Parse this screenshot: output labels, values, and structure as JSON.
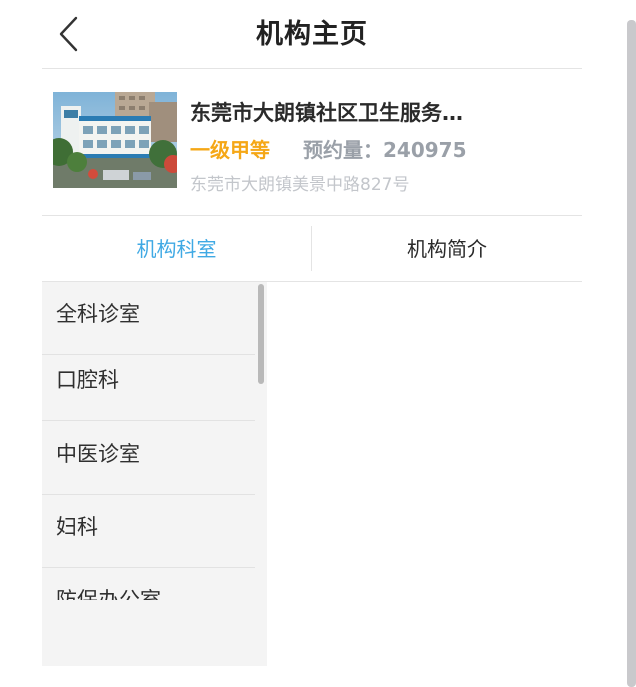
{
  "header": {
    "title": "机构主页"
  },
  "org": {
    "name": "东莞市大朗镇社区卫生服务…",
    "level": "一级甲等",
    "appointments": "预约量：240975",
    "address": "东莞市大朗镇美景中路827号"
  },
  "tabs": [
    {
      "label": "机构科室",
      "active": true
    },
    {
      "label": "机构简介",
      "active": false
    }
  ],
  "departments": [
    {
      "label": "全科诊室"
    },
    {
      "label": "口腔科"
    },
    {
      "label": "中医诊室"
    },
    {
      "label": "妇科"
    },
    {
      "label": "防保办公室"
    }
  ],
  "colors": {
    "active_tab": "#3fa9e4",
    "level": "#f5a716",
    "muted": "#9aa0a8",
    "panel_bg": "#f4f4f4"
  }
}
